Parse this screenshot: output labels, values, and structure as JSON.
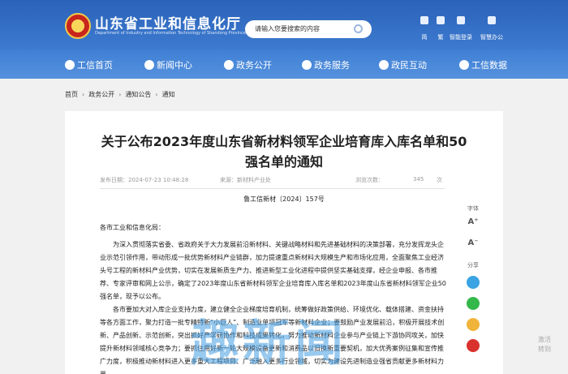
{
  "header": {
    "site_title": "山东省工业和信息化厅",
    "site_subtitle": "Department of Industry and Information Technology of Shandong Province",
    "search_placeholder": "请输入您要搜索的内容",
    "links": [
      {
        "label": "简",
        "icon": "accessibility-icon"
      },
      {
        "label": "繁",
        "icon": "text-icon"
      },
      {
        "label": "智能登录",
        "icon": "user-icon"
      },
      {
        "label": "智慧办公",
        "icon": "office-icon"
      }
    ]
  },
  "nav": {
    "items": [
      {
        "label": "工信首页",
        "icon": "home-icon"
      },
      {
        "label": "新闻中心",
        "icon": "news-icon"
      },
      {
        "label": "政务公开",
        "icon": "document-icon"
      },
      {
        "label": "政务服务",
        "icon": "service-icon"
      },
      {
        "label": "政民互动",
        "icon": "interaction-icon"
      },
      {
        "label": "工信数据",
        "icon": "data-icon"
      }
    ]
  },
  "breadcrumb": [
    "首页",
    "政务公开",
    "通知公告",
    "通知"
  ],
  "article": {
    "title": "关于公布2023年度山东省新材料领军企业培育库入库名单和50强名单的通知",
    "source_label": "发布日期：2024-07-23 10:48:28",
    "origin_label": "来源：新材料产业处",
    "views_label": "浏览次数：",
    "views": "345",
    "times": "次",
    "doc_no": "鲁工信新材〔2024〕157号",
    "salutation": "各市工业和信息化局：",
    "para1": "为深入贯彻落实省委、省政府关于大力发展前沿新材料、关键战略材料和先进基础材料的决策部署，充分发挥龙头企业示范引领作用，带动形成一批优势新材料产业链群，加力提速重点新材料大规模生产和市场化应用，全面聚焦工业经济头号工程的新材料产业优势，切实在发展新质生产力、推进新型工业化进程中提供坚实基础支撑，经企业申报、各市推荐、专家评审和网上公示，确定了2023年度山东省新材料领军企业培育库入库名单和2023年度山东省新材料领军企业50强名单，现予以公布。",
    "para2": "各市要加大对入库企业支持力度，建立健全企业梯度培育机制，统筹做好政策供给、环境优化、载体搭建、资金扶持等各方面工作，聚力打造一批专精特新“小巨人”、制造业单项冠军等新材料企业；要鼓励产业发展前沿，积极开展技术创新、产品创新、示范创新，突出抓好产学研协作和科技成果转化，努力推动新材料企业参与产业链上下游协同攻关，加快提升新材料领域核心竞争力；要抓住用好新一轮大规模设备更新和消费品以旧换新重要契机，加大优秀案例征集和宣传推广力度，积极推动新材料进入更多重大工程项目、广泛融入更多行业领域，切实为建设先进制造业强省贡献更多新材料力量。"
  },
  "tools": {
    "font_label": "字体",
    "font_up": "A⁺",
    "font_down": "A⁻",
    "share_label": "分享"
  },
  "watermark": "趣新闻",
  "win_mark": [
    "激活",
    "转到"
  ]
}
